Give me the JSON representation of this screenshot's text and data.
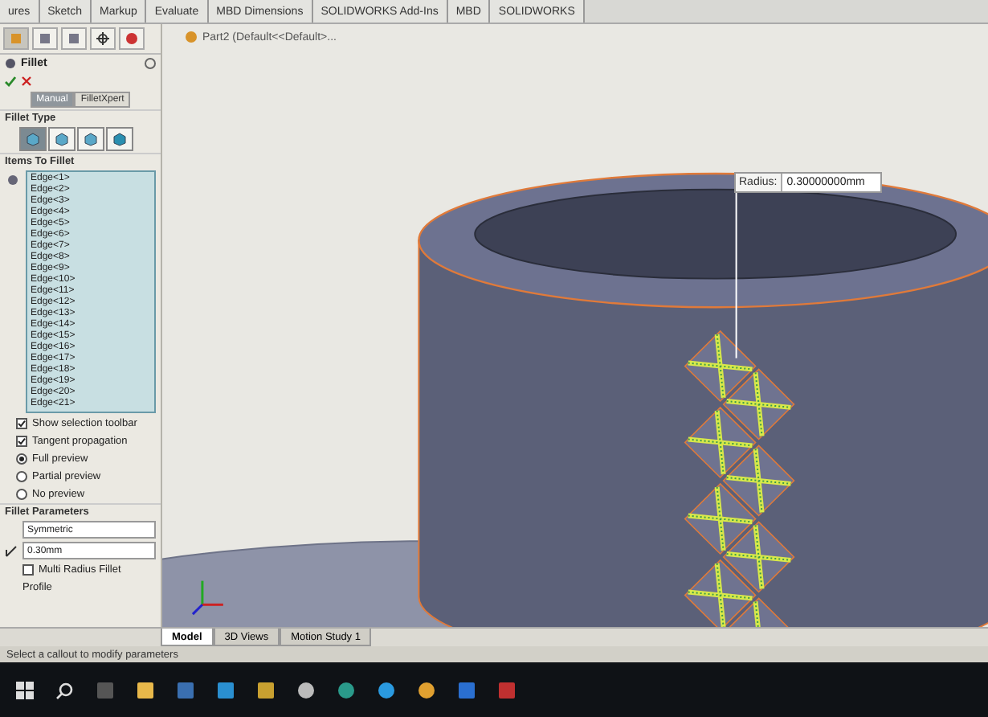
{
  "ribbon_tabs": [
    "ures",
    "Sketch",
    "Markup",
    "Evaluate",
    "MBD Dimensions",
    "SOLIDWORKS Add-Ins",
    "MBD",
    "SOLIDWORKS"
  ],
  "panel_tabs": [
    {
      "selected": true
    },
    {
      "selected": false
    },
    {
      "selected": false
    },
    {
      "selected": false
    },
    {
      "selected": false
    }
  ],
  "feature_tree": {
    "part": "Part2  (Default<<Default>..."
  },
  "property_manager": {
    "title": "Fillet",
    "modes": [
      {
        "label": "Manual",
        "selected": true
      },
      {
        "label": "FilletXpert",
        "selected": false
      }
    ],
    "fillet_type": {
      "heading": "Fillet Type",
      "types": [
        {
          "selected": true
        },
        {
          "selected": false
        },
        {
          "selected": false
        },
        {
          "selected": false
        }
      ]
    },
    "items": {
      "heading": "Items To Fillet",
      "edges": [
        "Edge<1>",
        "Edge<2>",
        "Edge<3>",
        "Edge<4>",
        "Edge<5>",
        "Edge<6>",
        "Edge<7>",
        "Edge<8>",
        "Edge<9>",
        "Edge<10>",
        "Edge<11>",
        "Edge<12>",
        "Edge<13>",
        "Edge<14>",
        "Edge<15>",
        "Edge<16>",
        "Edge<17>",
        "Edge<18>",
        "Edge<19>",
        "Edge<20>",
        "Edge<21>"
      ]
    },
    "options": [
      {
        "kind": "checkbox",
        "label": "Show selection toolbar",
        "checked": true
      },
      {
        "kind": "checkbox",
        "label": "Tangent propagation",
        "checked": true
      },
      {
        "kind": "radio",
        "label": "Full preview",
        "selected": true
      },
      {
        "kind": "radio",
        "label": "Partial preview",
        "selected": false
      },
      {
        "kind": "radio",
        "label": "No preview",
        "selected": false
      }
    ],
    "parameters": {
      "heading": "Fillet Parameters",
      "method": "Symmetric",
      "radius": "0.30mm",
      "multi_radius": {
        "label": "Multi Radius Fillet",
        "checked": false
      },
      "profile_label": "Profile"
    }
  },
  "callout": {
    "label": "Radius:",
    "value": "0.30000000mm"
  },
  "bottom_tabs": [
    {
      "label": "Model",
      "selected": true
    },
    {
      "label": "3D Views",
      "selected": false
    },
    {
      "label": "Motion Study 1",
      "selected": false
    }
  ],
  "status_bar": "Select a callout to modify parameters"
}
